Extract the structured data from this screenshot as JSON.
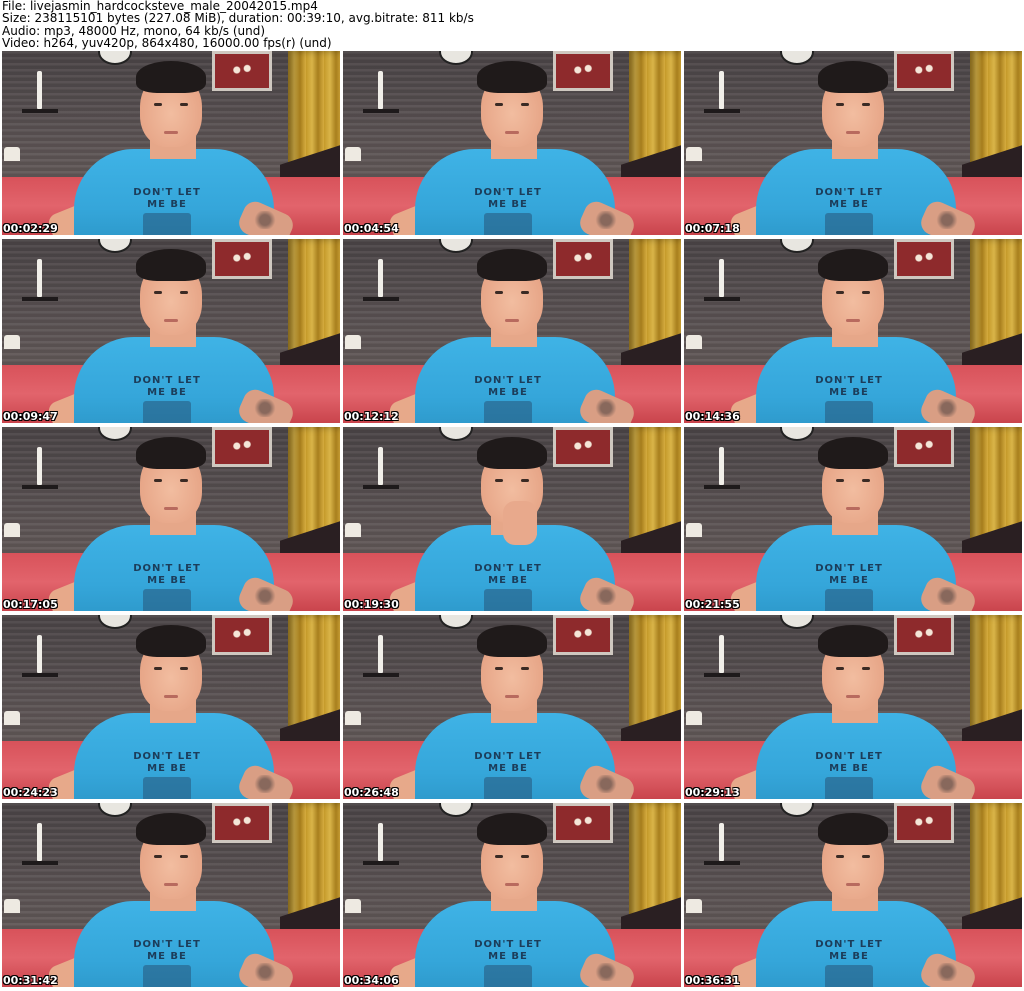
{
  "header": {
    "file_line": "File: livejasmin_hardcocksteve_male_20042015.mp4",
    "size_line": "Size: 238115101 bytes (227.08 MiB), duration: 00:39:10, avg.bitrate: 811 kb/s",
    "audio_line": "Audio: mp3, 48000 Hz, mono, 64 kb/s (und)",
    "video_line": "Video: h264, yuv420p, 864x480, 16000.00 fps(r) (und)"
  },
  "shirt_text": "DON'T LET ME BE",
  "thumbnails": [
    {
      "timestamp": "00:02:29"
    },
    {
      "timestamp": "00:04:54"
    },
    {
      "timestamp": "00:07:18"
    },
    {
      "timestamp": "00:09:47"
    },
    {
      "timestamp": "00:12:12"
    },
    {
      "timestamp": "00:14:36"
    },
    {
      "timestamp": "00:17:05"
    },
    {
      "timestamp": "00:19:30"
    },
    {
      "timestamp": "00:21:55"
    },
    {
      "timestamp": "00:24:23"
    },
    {
      "timestamp": "00:26:48"
    },
    {
      "timestamp": "00:29:13"
    },
    {
      "timestamp": "00:31:42"
    },
    {
      "timestamp": "00:34:06"
    },
    {
      "timestamp": "00:36:31"
    }
  ],
  "colors": {
    "shirt": "#3fb3e6",
    "bedspread": "#d8525a",
    "curtain": "#c59a2a",
    "wall": "#4a4446",
    "timestamp_text": "#ffffff"
  }
}
